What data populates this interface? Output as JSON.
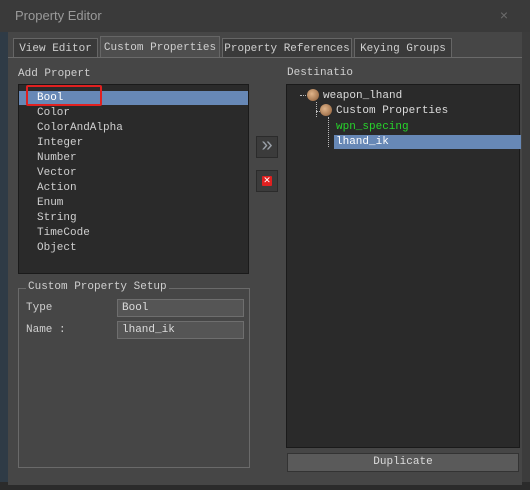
{
  "window": {
    "title": "Property Editor",
    "close_glyph": "×"
  },
  "tabs": [
    {
      "label": "View Editor"
    },
    {
      "label": "Custom Properties"
    },
    {
      "label": "Property References"
    },
    {
      "label": "Keying Groups"
    }
  ],
  "add_property": {
    "label": "Add Propert",
    "items": [
      "Bool",
      "Color",
      "ColorAndAlpha",
      "Integer",
      "Number",
      "Vector",
      "Action",
      "Enum",
      "String",
      "TimeCode",
      "Object"
    ],
    "selected": "Bool"
  },
  "destination": {
    "label": "Destinatio",
    "tree": {
      "root": "weapon_lhand",
      "group": "Custom Properties",
      "children": [
        "wpn_specing",
        "lhand_ik"
      ],
      "selected": "lhand_ik"
    }
  },
  "setup": {
    "title": "Custom Property Setup",
    "type_label": "Type",
    "type_value": "Bool",
    "name_label": "Name :",
    "name_value": "lhand_ik"
  },
  "buttons": {
    "add_glyph": "»",
    "remove_glyph": "✕",
    "duplicate": "Duplicate"
  },
  "colors": {
    "selection": "#6788b6",
    "green_item": "#27d42b",
    "remove_red": "#e02020"
  }
}
